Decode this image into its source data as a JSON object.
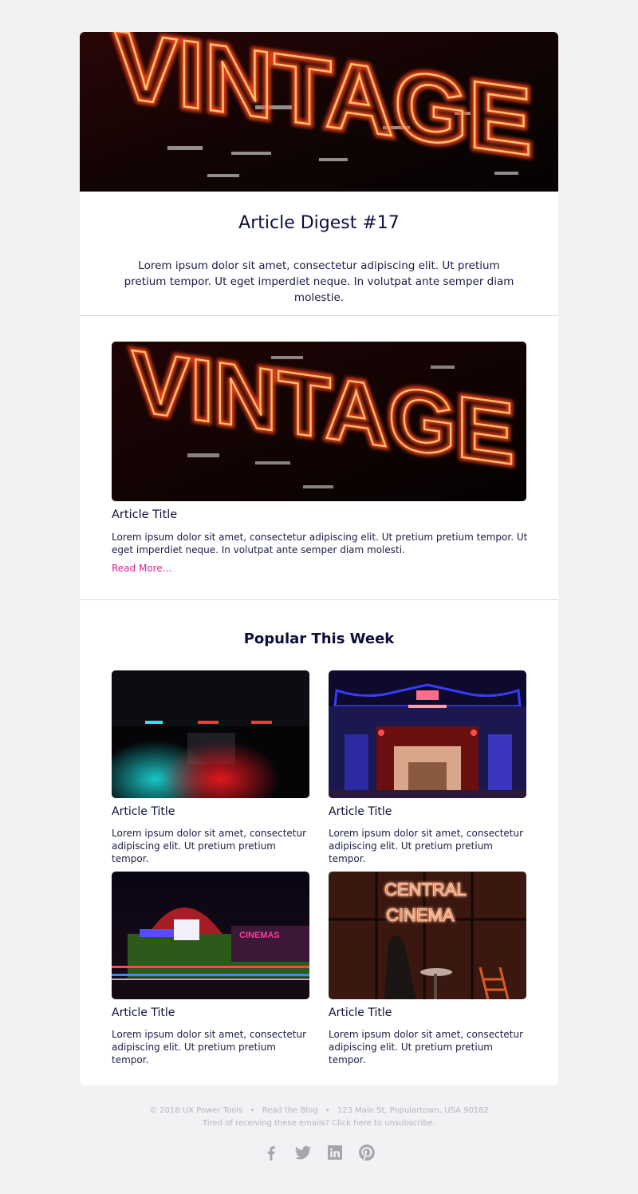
{
  "digest": {
    "title": "Article Digest #17",
    "intro": "Lorem ipsum dolor sit amet, consectetur adipiscing elit. Ut pretium pretium tempor. Ut eget imperdiet neque. In volutpat ante semper diam molestie."
  },
  "feature": {
    "title": "Article Title",
    "body": "Lorem ipsum dolor sit amet, consectetur adipiscing elit. Ut pretium pretium tempor. Ut eget imperdiet neque. In volutpat ante semper diam molesti.",
    "read_more": "Read More..."
  },
  "popular": {
    "heading": "Popular This Week",
    "items": [
      {
        "title": "Article Title",
        "body": "Lorem ipsum dolor sit amet, consectetur adipiscing elit. Ut pretium pretium tempor."
      },
      {
        "title": "Article Title",
        "body": "Lorem ipsum dolor sit amet, consectetur adipiscing elit. Ut pretium pretium tempor."
      },
      {
        "title": "Article Title",
        "body": "Lorem ipsum dolor sit amet, consectetur adipiscing elit. Ut pretium pretium tempor."
      },
      {
        "title": "Article Title",
        "body": "Lorem ipsum dolor sit amet, consectetur adipiscing elit. Ut pretium pretium tempor."
      }
    ]
  },
  "images": {
    "hero_sign": "VINTAGE",
    "tile_3_sign": "CINEMAS",
    "tile_4_sign_top": "CENTRAL",
    "tile_4_sign_bottom": "CINEMA"
  },
  "footer": {
    "copyright": "© 2018 UX Power Tools",
    "blog_link": "Read the Blog",
    "address": "123 Main St, Populartown, USA 90182",
    "separator": "•",
    "unsubscribe": "Tired of receiving these emails? Click here to unsubscribe."
  },
  "social": [
    "facebook-icon",
    "twitter-icon",
    "linkedin-icon",
    "pinterest-icon"
  ],
  "colors": {
    "page_bg": "#f2f2f4",
    "card_bg": "#ffffff",
    "text": "#0b0f3a",
    "link": "#e0209a",
    "footer_text": "#b6b6bf",
    "icon": "#a5a7ae"
  }
}
